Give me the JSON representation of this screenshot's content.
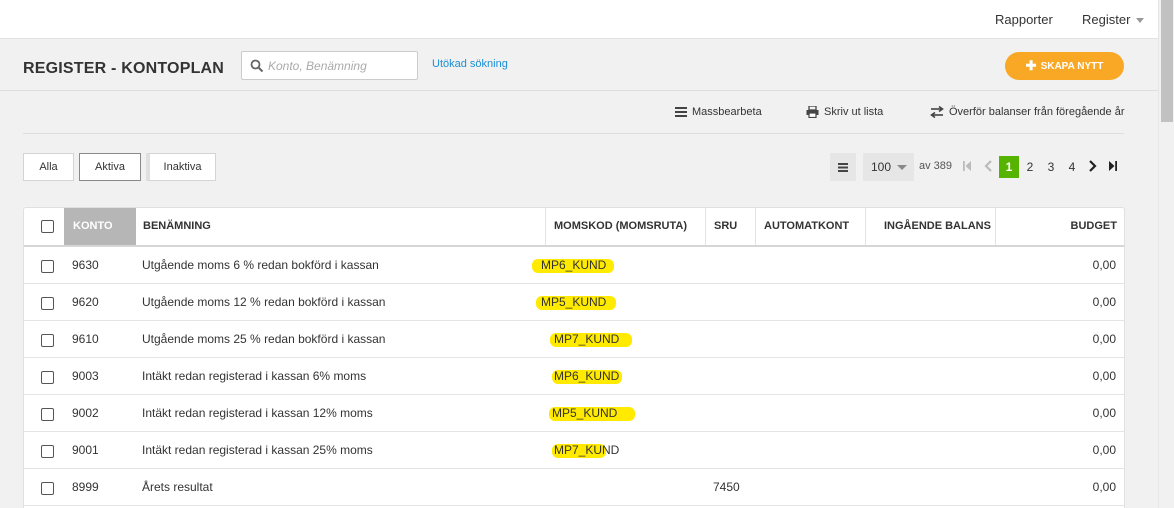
{
  "topbar": {
    "reports": "Rapporter",
    "register": "Register"
  },
  "header": {
    "title": "REGISTER - KONTOPLAN",
    "search_placeholder": "Konto, Benämning",
    "advanced_search": "Utökad sökning",
    "create_button": "SKAPA NYTT"
  },
  "actions": {
    "bulk_edit": "Massbearbeta",
    "print_list": "Skriv ut lista",
    "transfer_balances": "Överför balanser från föregående år"
  },
  "filters": {
    "all": "Alla",
    "active": "Aktiva",
    "inactive": "Inaktiva",
    "selected": "Aktiva"
  },
  "pager": {
    "per_page": "100",
    "of_total": "av 389",
    "pages": [
      "1",
      "2",
      "3",
      "4"
    ],
    "current_page": "1"
  },
  "table": {
    "columns": {
      "konto": "KONTO",
      "benamning": "BENÄMNING",
      "momskod": "MOMSKOD (MOMSRUTA)",
      "sru": "SRU",
      "automatkont": "AUTOMATKONT",
      "ingaende": "INGÅENDE BALANS",
      "budget": "BUDGET"
    },
    "rows": [
      {
        "konto": "9630",
        "benamning": "Utgående moms 6 % redan bokförd i kassan",
        "momskod": "MP6_KUND",
        "sru": "",
        "automatkont": "",
        "ingaende": "",
        "budget": "0,00"
      },
      {
        "konto": "9620",
        "benamning": "Utgående moms 12 % redan bokförd i kassan",
        "momskod": "MP5_KUND",
        "sru": "",
        "automatkont": "",
        "ingaende": "",
        "budget": "0,00"
      },
      {
        "konto": "9610",
        "benamning": "Utgående moms 25 % redan bokförd i kassan",
        "momskod": "MP7_KUND",
        "sru": "",
        "automatkont": "",
        "ingaende": "",
        "budget": "0,00"
      },
      {
        "konto": "9003",
        "benamning": "Intäkt redan registerad i kassan 6% moms",
        "momskod": "MP6_KUND",
        "sru": "",
        "automatkont": "",
        "ingaende": "",
        "budget": "0,00"
      },
      {
        "konto": "9002",
        "benamning": "Intäkt redan registerad i kassan 12% moms",
        "momskod": "MP5_KUND",
        "sru": "",
        "automatkont": "",
        "ingaende": "",
        "budget": "0,00"
      },
      {
        "konto": "9001",
        "benamning": "Intäkt redan registerad i kassan 25% moms",
        "momskod": "MP7_KUND",
        "sru": "",
        "automatkont": "",
        "ingaende": "",
        "budget": "0,00"
      },
      {
        "konto": "8999",
        "benamning": "Årets resultat",
        "momskod": "",
        "sru": "7450",
        "automatkont": "",
        "ingaende": "",
        "budget": "0,00"
      }
    ]
  },
  "colors": {
    "accent_orange": "#f9a825",
    "active_page_green": "#56b300",
    "link_blue": "#1a8fd4",
    "highlight_yellow": "#ffea00",
    "sorted_header_gray": "#b6b6b6"
  }
}
